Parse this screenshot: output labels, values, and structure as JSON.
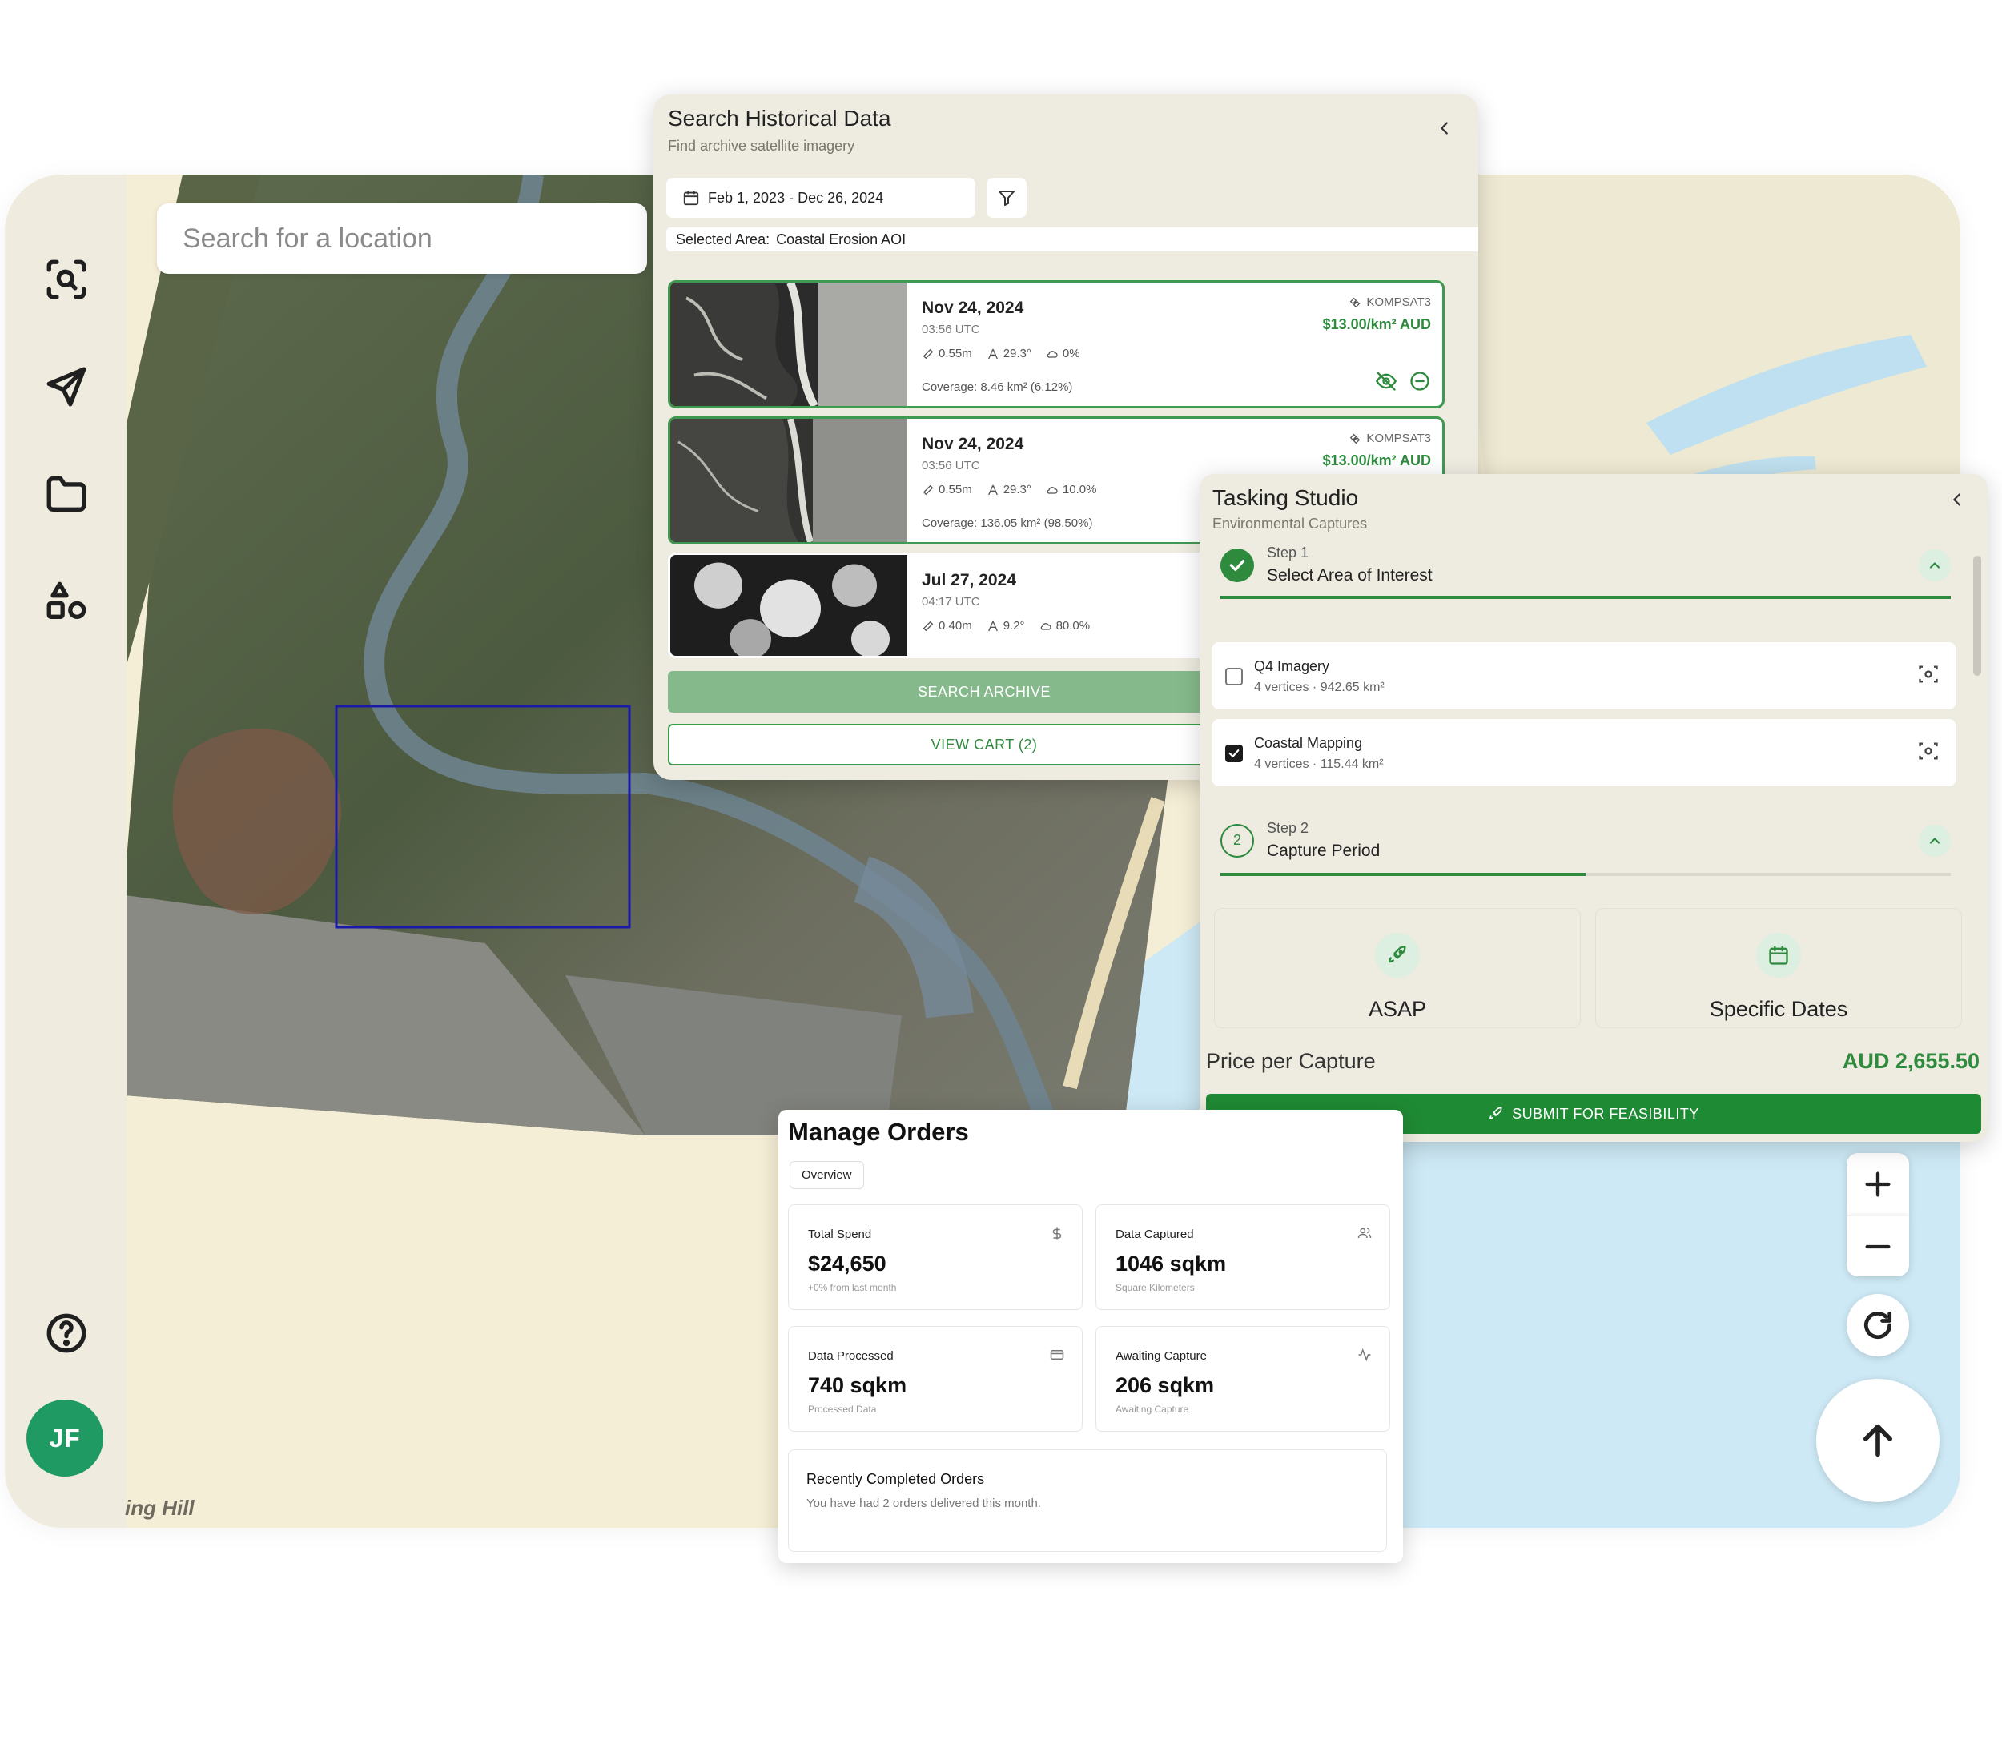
{
  "search": {
    "placeholder": "Search for a location"
  },
  "map": {
    "place_label": "ing Hill"
  },
  "user": {
    "initials": "JF"
  },
  "historical": {
    "title": "Search Historical Data",
    "subtitle": "Find archive satellite imagery",
    "date_range": "Feb 1, 2023 - Dec 26, 2024",
    "selected_area_label": "Selected Area:",
    "selected_area_value": "Coastal Erosion AOI",
    "results": [
      {
        "date": "Nov 24, 2024",
        "time": "03:56 UTC",
        "resolution": "0.55m",
        "angle": "29.3°",
        "cloud": "0%",
        "coverage": "Coverage: 8.46 km² (6.12%)",
        "satellite": "KOMPSAT3",
        "price": "$13.00/km² AUD"
      },
      {
        "date": "Nov 24, 2024",
        "time": "03:56 UTC",
        "resolution": "0.55m",
        "angle": "29.3°",
        "cloud": "10.0%",
        "coverage": "Coverage: 136.05 km² (98.50%)",
        "satellite": "KOMPSAT3",
        "price": "$13.00/km² AUD"
      },
      {
        "date": "Jul 27, 2024",
        "time": "04:17 UTC",
        "resolution": "0.40m",
        "angle": "9.2°",
        "cloud": "80.0%"
      }
    ],
    "search_button": "SEARCH ARCHIVE",
    "cart_button": "VIEW CART (2)"
  },
  "tasking": {
    "title": "Tasking Studio",
    "subtitle": "Environmental Captures",
    "step1": {
      "number": "Step 1",
      "name": "Select Area of Interest"
    },
    "aois": [
      {
        "name": "Q4 Imagery",
        "info": "4 vertices · 942.65 km²",
        "checked": false
      },
      {
        "name": "Coastal Mapping",
        "info": "4 vertices · 115.44 km²",
        "checked": true
      }
    ],
    "step2": {
      "number": "Step 2",
      "badge": "2",
      "name": "Capture Period"
    },
    "options": [
      "ASAP",
      "Specific Dates"
    ],
    "price_label": "Price per Capture",
    "price_value": "AUD 2,655.50",
    "submit_button": "SUBMIT FOR FEASIBILITY",
    "step2_progress": 0.5
  },
  "orders": {
    "title": "Manage Orders",
    "tab": "Overview",
    "stats": [
      {
        "label": "Total Spend",
        "value": "$24,650",
        "sub": "+0% from last month",
        "icon": "dollar-icon"
      },
      {
        "label": "Data Captured",
        "value": "1046 sqkm",
        "sub": "Square Kilometers",
        "icon": "users-icon"
      },
      {
        "label": "Data Processed",
        "value": "740 sqkm",
        "sub": "Processed Data",
        "icon": "card-icon"
      },
      {
        "label": "Awaiting Capture",
        "value": "206 sqkm",
        "sub": "Awaiting Capture",
        "icon": "activity-icon"
      }
    ],
    "recent_title": "Recently Completed Orders",
    "recent_desc": "You have had 2 orders delivered this month."
  },
  "colors": {
    "accent": "#2e8b3e",
    "avatar": "#1f9a63",
    "selection_box": "#1a1aa8"
  }
}
